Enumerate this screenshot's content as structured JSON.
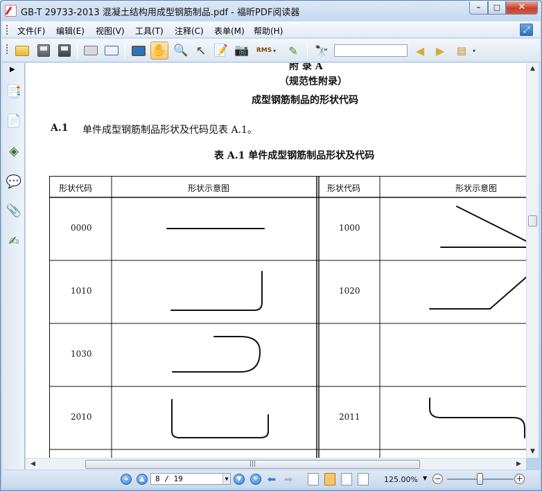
{
  "window": {
    "title": "GB-T 29733-2013  混凝土结构用成型钢筋制品.pdf - 福昕PDF阅读器",
    "controls": {
      "minimize": "–",
      "maximize": "□",
      "close": "✕"
    }
  },
  "menubar": {
    "items": [
      "文件(F)",
      "编辑(E)",
      "视图(V)",
      "工具(T)",
      "注释(C)",
      "表单(M)",
      "帮助(H)"
    ]
  },
  "toolbar": {
    "icons": [
      "open-folder-icon",
      "save-icon",
      "save-as-icon",
      "print-icon",
      "email-icon",
      "fullscreen-icon",
      "hand-icon",
      "zoom-icon",
      "select-icon",
      "text-select-icon",
      "snapshot-icon",
      "rms-icon",
      "sign-icon",
      "find-icon",
      "prev-result-icon",
      "next-result-icon",
      "highlight-icon"
    ],
    "rms_label": "RMS",
    "search": {
      "value": ""
    }
  },
  "document": {
    "annex_heading": "附  录  A",
    "annex_type": "（规范性附录）",
    "annex_title": "成型钢筋制品的形状代码",
    "clause_num": "A.1",
    "clause_text": "单件成型钢筋制品形状及代码见表 A.1。",
    "table_caption": "表 A.1    单件成型钢筋制品形状及代码",
    "table": {
      "headers": [
        "形状代码",
        "形状示意图",
        "形状代码",
        "形状示意图"
      ],
      "rows": [
        {
          "left_code": "0000",
          "right_code": "1000"
        },
        {
          "left_code": "1010",
          "right_code": "1020"
        },
        {
          "left_code": "1030",
          "right_code": ""
        },
        {
          "left_code": "2010",
          "right_code": "2011"
        }
      ]
    }
  },
  "statusbar": {
    "page_display": "8 / 19",
    "zoom": "125.00%",
    "zoom_level_fraction": 0.45
  },
  "colors": {
    "titlebar": "#c4d8ef",
    "close_button": "#c8412b",
    "active_tool": "#f5c777"
  }
}
